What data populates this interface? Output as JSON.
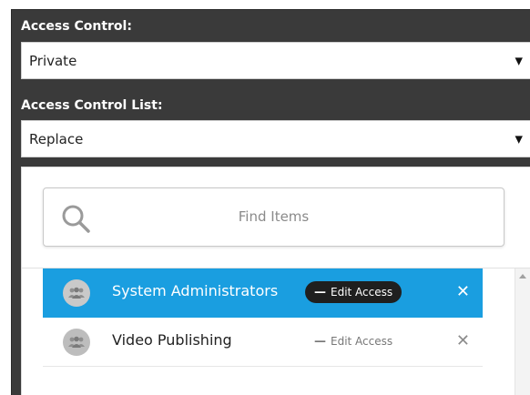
{
  "access_control": {
    "label": "Access Control:",
    "selected": "Private"
  },
  "access_control_list": {
    "label": "Access Control List:",
    "selected": "Replace"
  },
  "search": {
    "placeholder": "Find Items"
  },
  "items": [
    {
      "name": "System Administrators",
      "edit_label": "Edit Access",
      "selected": true
    },
    {
      "name": "Video Publishing",
      "edit_label": "Edit Access",
      "selected": false
    }
  ],
  "colors": {
    "panel_bg": "#3a3a3a",
    "selected_row": "#1a9ee0",
    "pill_bg": "#1f1f1f"
  },
  "icons": {
    "dropdown": "caret-down-icon",
    "search": "search-icon",
    "group": "users-icon",
    "remove": "close-icon",
    "edit": "minus-icon"
  }
}
